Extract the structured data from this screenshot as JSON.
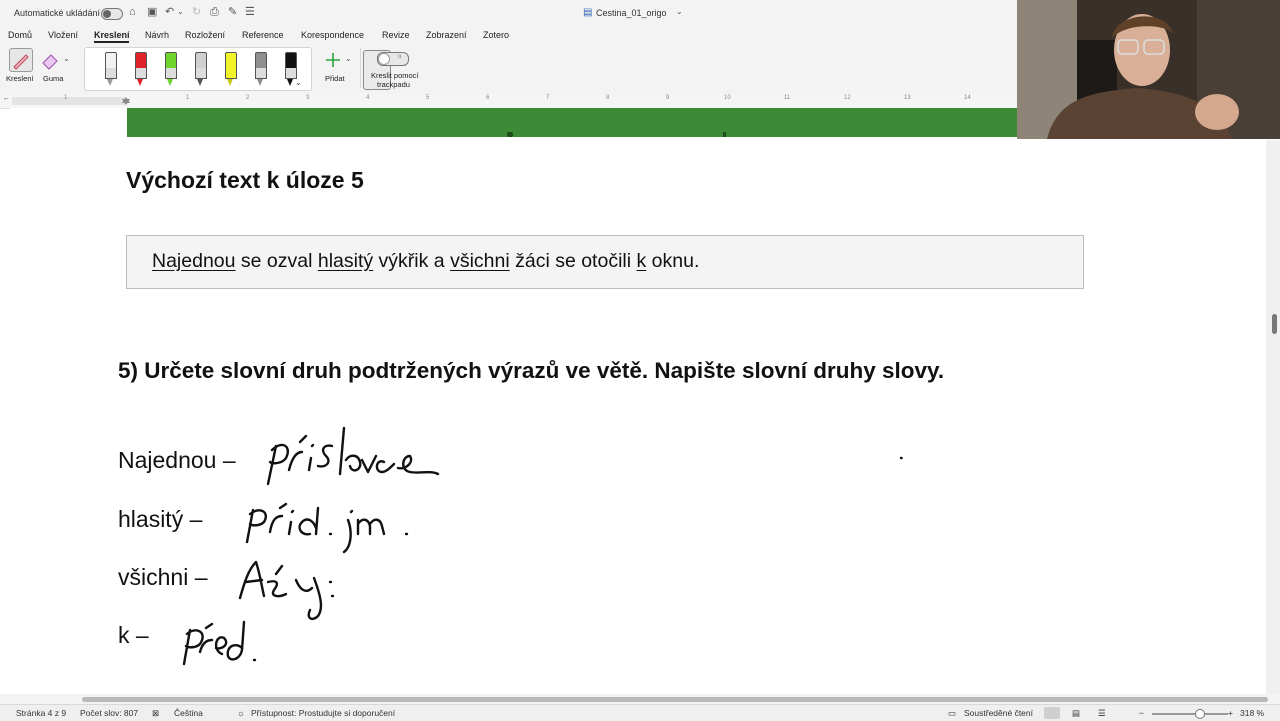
{
  "titlebar": {
    "autosave_label": "Automatické ukládání",
    "document_title": "Cestina_01_origo"
  },
  "ribbon_tabs": [
    "Domů",
    "Vložení",
    "Kreslení",
    "Návrh",
    "Rozložení",
    "Reference",
    "Korespondence",
    "Revize",
    "Zobrazení",
    "Zotero"
  ],
  "active_tab": "Kreslení",
  "ribbon": {
    "drawing_label": "Kreslení",
    "eraser_label": "Guma",
    "add_label": "Přidat",
    "trackpad_label_line1": "Kreslit pomocí",
    "trackpad_label_line2": "trackpadu",
    "pens": [
      {
        "name": "pencil-gray",
        "color": "#9a9a9a"
      },
      {
        "name": "pen-red",
        "color": "#e0222b"
      },
      {
        "name": "pen-green",
        "color": "#6fd42c"
      },
      {
        "name": "pencil-dark",
        "color": "#7b7b7b"
      },
      {
        "name": "highlighter-yellow",
        "color": "#f2f22a"
      },
      {
        "name": "pencil-gray-2",
        "color": "#8f8f8f"
      },
      {
        "name": "pen-black",
        "color": "#111111"
      }
    ]
  },
  "ruler": {
    "numbers": [
      "1",
      "1",
      "2",
      "3",
      "4",
      "5",
      "6",
      "7",
      "8",
      "9",
      "10",
      "11",
      "12",
      "13",
      "14"
    ]
  },
  "document": {
    "section_title": "Výchozí text k úloze 5",
    "sentence_parts": [
      {
        "text": "Najednou",
        "underline": true
      },
      {
        "text": " se ozval ",
        "underline": false
      },
      {
        "text": "hlasitý",
        "underline": true
      },
      {
        "text": " výkřik a ",
        "underline": false
      },
      {
        "text": "všichni",
        "underline": true
      },
      {
        "text": " žáci se otočili ",
        "underline": false
      },
      {
        "text": "k",
        "underline": true
      },
      {
        "text": " oknu.",
        "underline": false
      }
    ],
    "task": "5)  Určete slovní druh podtržených výrazů ve větě. Napište slovní druhy slovy.",
    "answers": [
      {
        "label": "Najednou –",
        "handwritten": "příslovce"
      },
      {
        "label": "hlasitý –",
        "handwritten": "příd. jm."
      },
      {
        "label": "všichni –",
        "handwritten": "záj."
      },
      {
        "label": "k –",
        "handwritten": "před."
      }
    ],
    "accent_color": "#3d8b37"
  },
  "statusbar": {
    "page": "Stránka 4 z 9",
    "words": "Počet slov: 807",
    "language": "Čeština",
    "accessibility": "Přístupnost: Prostudujte si doporučení",
    "focus": "Soustředěné čtení",
    "zoom": "318 %"
  }
}
